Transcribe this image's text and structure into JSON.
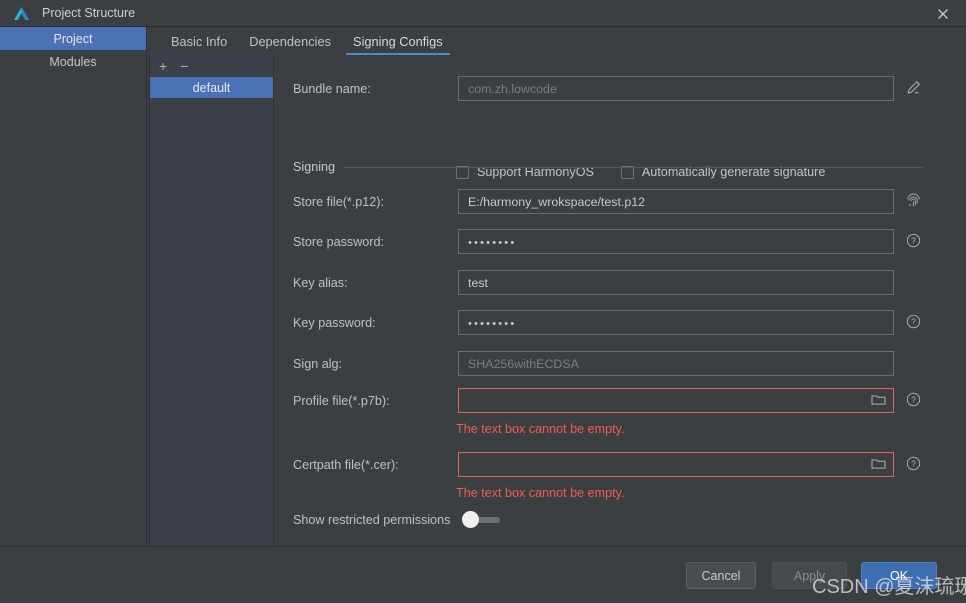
{
  "window": {
    "title": "Project Structure",
    "logo_icon": "deveco-logo-icon",
    "close_icon": "close-icon",
    "accent_color": "#4a71b5",
    "error_color": "#f05c52",
    "tab_underline_color": "#4a88c7"
  },
  "sidebar": {
    "items": [
      {
        "label": "Project",
        "selected": true
      },
      {
        "label": "Modules",
        "selected": false
      }
    ]
  },
  "tabs": [
    {
      "label": "Basic Info",
      "active": false
    },
    {
      "label": "Dependencies",
      "active": false
    },
    {
      "label": "Signing Configs",
      "active": true
    }
  ],
  "config_list": {
    "add_icon": "plus-icon",
    "remove_icon": "minus-icon",
    "add_label": "+",
    "remove_label": "−",
    "items": [
      {
        "label": "default",
        "selected": true
      }
    ]
  },
  "form": {
    "bundle": {
      "label": "Bundle name:",
      "placeholder": "com.zh.lowcode",
      "value": "",
      "edit_icon": "pencil-icon"
    },
    "checkboxes": [
      {
        "label": "Support HarmonyOS",
        "checked": false
      },
      {
        "label": "Automatically generate signature",
        "checked": false
      }
    ],
    "section_title": "Signing",
    "fields": [
      {
        "label": "Store file(*.p12):",
        "value": "E:/harmony_wrokspace/test.p12",
        "placeholder": "",
        "masked": false,
        "error": false,
        "browse_icon": "folder-icon",
        "aside_icon": "fingerprint-icon",
        "error_text": ""
      },
      {
        "label": "Store password:",
        "value": "••••••••",
        "placeholder": "",
        "masked": true,
        "error": false,
        "browse_icon": "",
        "aside_icon": "help-icon",
        "error_text": ""
      },
      {
        "label": "Key alias:",
        "value": "test",
        "placeholder": "",
        "masked": false,
        "error": false,
        "browse_icon": "",
        "aside_icon": "",
        "error_text": ""
      },
      {
        "label": "Key password:",
        "value": "••••••••",
        "placeholder": "",
        "masked": true,
        "error": false,
        "browse_icon": "",
        "aside_icon": "help-icon",
        "error_text": ""
      },
      {
        "label": "Sign alg:",
        "value": "",
        "placeholder": "SHA256withECDSA",
        "masked": false,
        "error": false,
        "browse_icon": "",
        "aside_icon": "",
        "error_text": ""
      },
      {
        "label": "Profile file(*.p7b):",
        "value": "",
        "placeholder": "",
        "masked": false,
        "error": true,
        "browse_icon": "folder-icon",
        "aside_icon": "help-icon",
        "error_text": "The text box cannot be empty."
      },
      {
        "label": "Certpath file(*.cer):",
        "value": "",
        "placeholder": "",
        "masked": false,
        "error": true,
        "browse_icon": "folder-icon",
        "aside_icon": "help-icon",
        "error_text": "The text box cannot be empty."
      }
    ],
    "toggle": {
      "label": "Show restricted permissions",
      "enabled": false
    }
  },
  "buttons": {
    "cancel": "Cancel",
    "apply": "Apply",
    "ok": "OK"
  },
  "watermark": "CSDN @夏沫琉琊"
}
